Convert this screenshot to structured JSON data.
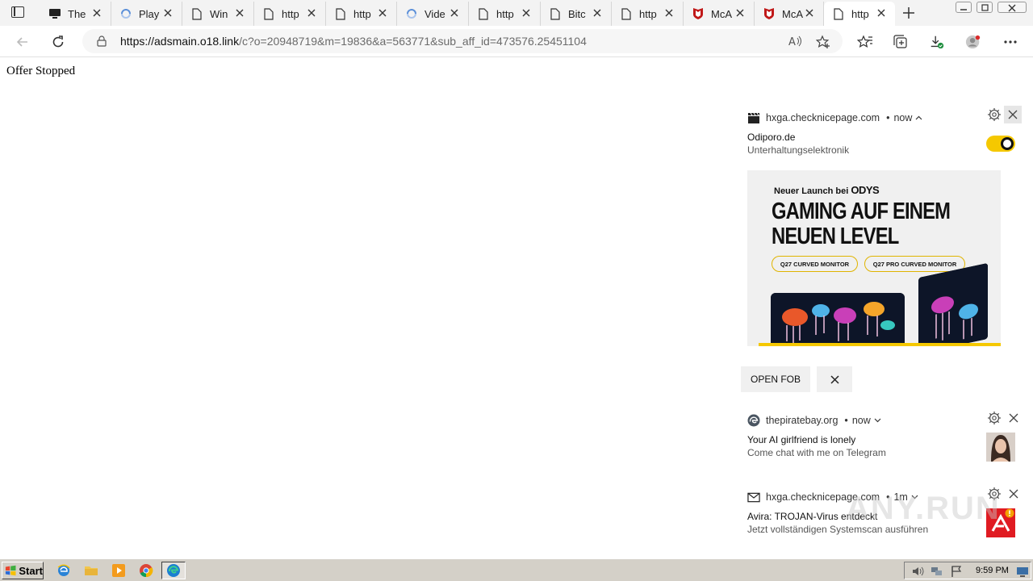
{
  "browser": {
    "tabs": [
      {
        "label": "The",
        "icon": "monitor-icon"
      },
      {
        "label": "Play",
        "icon": "loading-icon"
      },
      {
        "label": "Win",
        "icon": "page-icon"
      },
      {
        "label": "http",
        "icon": "page-icon"
      },
      {
        "label": "http",
        "icon": "page-icon"
      },
      {
        "label": "Vide",
        "icon": "loading-icon"
      },
      {
        "label": "http",
        "icon": "page-icon"
      },
      {
        "label": "Bitc",
        "icon": "page-icon"
      },
      {
        "label": "http",
        "icon": "page-icon"
      },
      {
        "label": "McA",
        "icon": "mcafee-icon"
      },
      {
        "label": "McA",
        "icon": "mcafee-icon"
      },
      {
        "label": "http",
        "icon": "page-icon",
        "active": true
      }
    ],
    "url_host": "https://adsmain.o18.link",
    "url_path": "/c?o=20948719&m=19836&a=563771&sub_aff_id=473576.25451104"
  },
  "page": {
    "message": "Offer Stopped"
  },
  "notifications": [
    {
      "source": "hxga.checknicepage.com",
      "time": "now",
      "title": "Odiporo.de",
      "body": "Unterhaltungselektronik",
      "ad": {
        "brand_prefix": "Neuer Launch bei",
        "brand": "ODYS",
        "headline_line1": "GAMING AUF EINEM",
        "headline_line2": "NEUEN LEVEL",
        "pill1": "Q27 CURVED MONITOR",
        "pill2": "Q27 PRO CURVED MONITOR"
      },
      "action_label": "OPEN FOB"
    },
    {
      "source": "thepiratebay.org",
      "time": "now",
      "title": "Your AI girlfriend is lonely",
      "body": "Come chat with me on Telegram"
    },
    {
      "source": "hxga.checknicepage.com",
      "time": "1m",
      "title": "Avira: TROJAN-Virus entdeckt",
      "body": "Jetzt vollständigen Systemscan ausführen"
    }
  ],
  "taskbar": {
    "start_label": "Start",
    "clock": "9:59 PM"
  },
  "watermark": "ANY.RUN",
  "colors": {
    "toggle": "#f5c800",
    "mcafee_red": "#c01818",
    "avira_red": "#e01b22"
  }
}
